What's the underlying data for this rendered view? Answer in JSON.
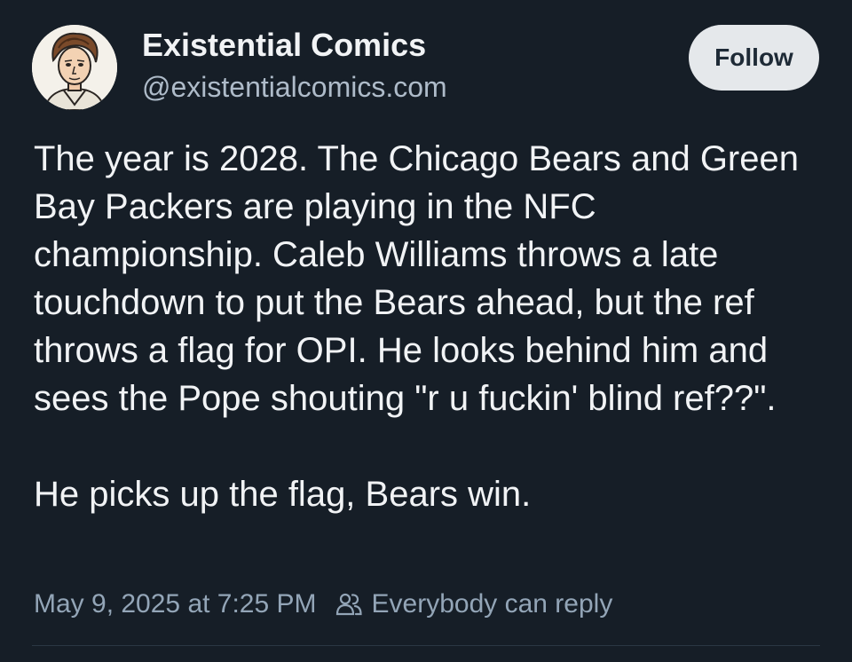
{
  "author": {
    "name": "Existential Comics",
    "handle": "@existentialcomics.com",
    "avatar_icon": "cartoon-portrait-avatar"
  },
  "actions": {
    "follow_label": "Follow"
  },
  "post": {
    "paragraph_1": "The year is 2028. The Chicago Bears and Green Bay Packers are playing in the NFC championship. Caleb Williams throws a late touchdown to put the Bears ahead, but the ref throws a flag for OPI. He looks behind him and sees the Pope shouting \"r u fuckin' blind ref??\".",
    "paragraph_2": "He picks up the flag, Bears win."
  },
  "meta": {
    "timestamp": "May 9, 2025 at 7:25 PM",
    "reply_setting": "Everybody can reply",
    "reply_icon": "people-icon"
  },
  "colors": {
    "background": "#161e27",
    "text": "#f1f3f5",
    "muted": "#93a5b7",
    "follow_bg": "#e5e8eb"
  }
}
